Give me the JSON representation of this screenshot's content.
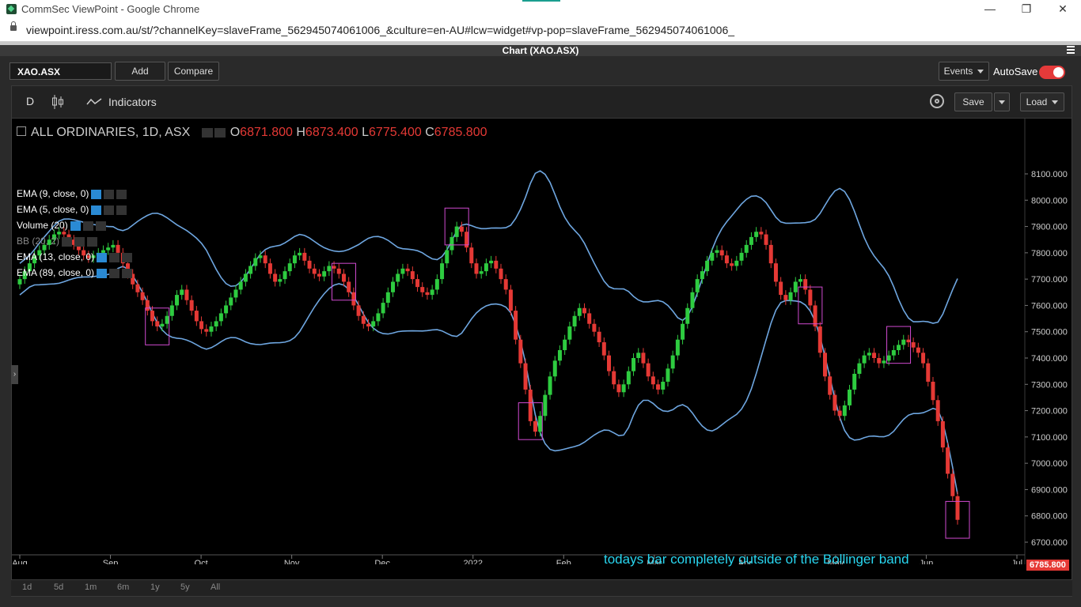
{
  "browser": {
    "title": "CommSec ViewPoint - Google Chrome",
    "url": "viewpoint.iress.com.au/st/?channelKey=slaveFrame_562945074061006_&culture=en-AU#lcw=widget#vp-pop=slaveFrame_562945074061006_",
    "minimize": "—",
    "restore": "❐",
    "close": "✕"
  },
  "panel": {
    "title": "Chart (XAO.ASX)",
    "symbol": "XAO.ASX",
    "add_label": "Add",
    "compare_label": "Compare",
    "events_label": "Events",
    "autosave_label": "AutoSave"
  },
  "chart_toolbar": {
    "interval": "D",
    "indicators_label": "Indicators",
    "save_label": "Save",
    "load_label": "Load"
  },
  "legend": {
    "main": "ALL ORDINARIES, 1D, ASX",
    "o_label": "O",
    "o": "6871.800",
    "h_label": "H",
    "h": "6873.400",
    "l_label": "L",
    "l": "6775.400",
    "c_label": "C",
    "c": "6785.800",
    "studies": [
      "EMA (9, close, 0)",
      "EMA (5, close, 0)",
      "Volume (20)",
      "BB (20, 2)",
      "EMA (13, close, 0)",
      "EMA (89, close, 0)"
    ]
  },
  "annotation": "todays bar completely outside of the Bollinger band",
  "last_price": "6785.800",
  "ranges": [
    "1d",
    "5d",
    "1m",
    "6m",
    "1y",
    "5y",
    "All"
  ],
  "chart_data": {
    "type": "candlestick",
    "title": "ALL ORDINARIES, 1D, ASX",
    "x_labels": [
      "Aug",
      "Sep",
      "Oct",
      "Nov",
      "Dec",
      "2022",
      "Feb",
      "Mar",
      "Apr",
      "May",
      "Jun",
      "Jul"
    ],
    "y_ticks": [
      "8100.000",
      "8000.000",
      "7900.000",
      "7800.000",
      "7700.000",
      "7600.000",
      "7500.000",
      "7400.000",
      "7300.000",
      "7200.000",
      "7100.000",
      "7000.000",
      "6900.000",
      "6800.000",
      "6700.000"
    ],
    "ylim": [
      6700,
      8100
    ],
    "up_color": "#2ecc40",
    "down_color": "#e53935",
    "band_color": "#6ea6e0",
    "box_color": "#d04ad0",
    "closes": [
      7700,
      7730,
      7760,
      7790,
      7810,
      7830,
      7850,
      7870,
      7880,
      7870,
      7850,
      7830,
      7810,
      7790,
      7780,
      7790,
      7800,
      7810,
      7820,
      7830,
      7800,
      7760,
      7720,
      7680,
      7650,
      7620,
      7580,
      7540,
      7520,
      7530,
      7560,
      7600,
      7640,
      7660,
      7620,
      7580,
      7540,
      7510,
      7500,
      7520,
      7540,
      7570,
      7600,
      7630,
      7660,
      7690,
      7720,
      7750,
      7780,
      7790,
      7760,
      7720,
      7690,
      7700,
      7730,
      7760,
      7790,
      7800,
      7770,
      7740,
      7720,
      7710,
      7730,
      7750,
      7740,
      7720,
      7690,
      7650,
      7600,
      7560,
      7530,
      7520,
      7540,
      7570,
      7610,
      7650,
      7690,
      7720,
      7740,
      7730,
      7700,
      7670,
      7650,
      7640,
      7660,
      7700,
      7760,
      7810,
      7860,
      7900,
      7880,
      7820,
      7760,
      7720,
      7730,
      7760,
      7770,
      7740,
      7700,
      7660,
      7580,
      7470,
      7380,
      7280,
      7160,
      7120,
      7180,
      7260,
      7330,
      7390,
      7430,
      7470,
      7520,
      7560,
      7590,
      7570,
      7530,
      7500,
      7460,
      7410,
      7350,
      7300,
      7270,
      7300,
      7350,
      7400,
      7420,
      7380,
      7330,
      7300,
      7280,
      7310,
      7360,
      7410,
      7470,
      7530,
      7590,
      7650,
      7700,
      7730,
      7770,
      7800,
      7810,
      7790,
      7760,
      7750,
      7770,
      7800,
      7830,
      7860,
      7880,
      7870,
      7830,
      7760,
      7690,
      7640,
      7620,
      7650,
      7690,
      7700,
      7660,
      7600,
      7520,
      7420,
      7330,
      7260,
      7200,
      7180,
      7220,
      7280,
      7340,
      7380,
      7410,
      7420,
      7400,
      7380,
      7390,
      7410,
      7430,
      7450,
      7470,
      7460,
      7440,
      7420,
      7380,
      7310,
      7240,
      7160,
      7060,
      6960,
      6875,
      6785
    ]
  }
}
